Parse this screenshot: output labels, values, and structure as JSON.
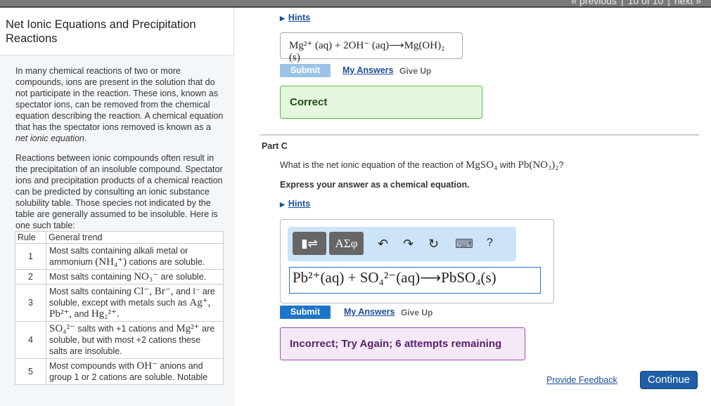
{
  "topnav": {
    "previous": "« previous",
    "page": "10 of 10",
    "next": "next »"
  },
  "title": "Net Ionic Equations and Precipitation Reactions",
  "intro": {
    "p1a": "In many chemical reactions of two or more compounds, ions are present in the solution that do not participate in the reaction. These ions, known as spectator ions, can be removed from the chemical equation describing the reaction. A chemical equation that has the spectator ions removed is known as a ",
    "p1b": "net ionic equation",
    "p1c": ".",
    "p2": "Reactions between ionic compounds often result in the precipitation of an insoluble compound. Spectator ions and precipitation products of a chemical reaction can be predicted by consulting an ionic substance solubility table. Those species not indicated by the table are generally assumed to be insoluble. Here is one such table:"
  },
  "table": {
    "headers": [
      "Rule",
      "General trend"
    ],
    "rows": [
      {
        "n": "1",
        "a": "Most salts containing alkali metal or ammonium ",
        "m": "(NH₄⁺)",
        "b": " cations are soluble."
      },
      {
        "n": "2",
        "a": "Most salts containing ",
        "m": "NO₃⁻",
        "b": " are soluble."
      },
      {
        "n": "3",
        "a": "Most salts containing ",
        "m": "Cl⁻, Br⁻,",
        "b": " and I⁻ are soluble, except with metals such as ",
        "m2": "Ag⁺, Pb²⁺,",
        "c": " and ",
        "m3": "Hg₂²⁺."
      },
      {
        "n": "4",
        "m": "SO₄²⁻",
        "a": " salts with +1 cations and ",
        "m2": "Mg²⁺",
        "b": " are soluble, but with most +2 cations these salts are insoluble."
      },
      {
        "n": "5",
        "a": "Most compounds with ",
        "m": "OH⁻",
        "b": " anions and group 1 or 2 cations are soluble. Notable"
      }
    ]
  },
  "partB": {
    "hints": "Hints",
    "answer": "Mg²⁺ (aq) + 2OH⁻ (aq)⟶Mg(OH)₂ (s)",
    "submit": "Submit",
    "my_answers": "My Answers",
    "give_up": "Give Up",
    "feedback": "Correct"
  },
  "partC": {
    "label": "Part C",
    "question_a": "What is the net ionic equation of the reaction of ",
    "q_m1": "MgSO₄",
    "question_b": " with ",
    "q_m2": "Pb(NO₃)₂",
    "question_c": "?",
    "instruction": "Express your answer as a chemical equation.",
    "hints": "Hints",
    "toolbar": {
      "templates": "▮⇌",
      "greek": "ΑΣφ",
      "undo": "↶",
      "redo": "↷",
      "reset": "↻",
      "keyboard": "⌨",
      "help": "?"
    },
    "answer": "Pb²⁺(aq) + SO₄²⁻(aq)⟶PbSO₄(s)",
    "submit": "Submit",
    "my_answers": "My Answers",
    "give_up": "Give Up",
    "feedback": "Incorrect; Try Again; 6 attempts remaining"
  },
  "footer": {
    "provide_feedback": "Provide Feedback",
    "continue": "Continue"
  }
}
